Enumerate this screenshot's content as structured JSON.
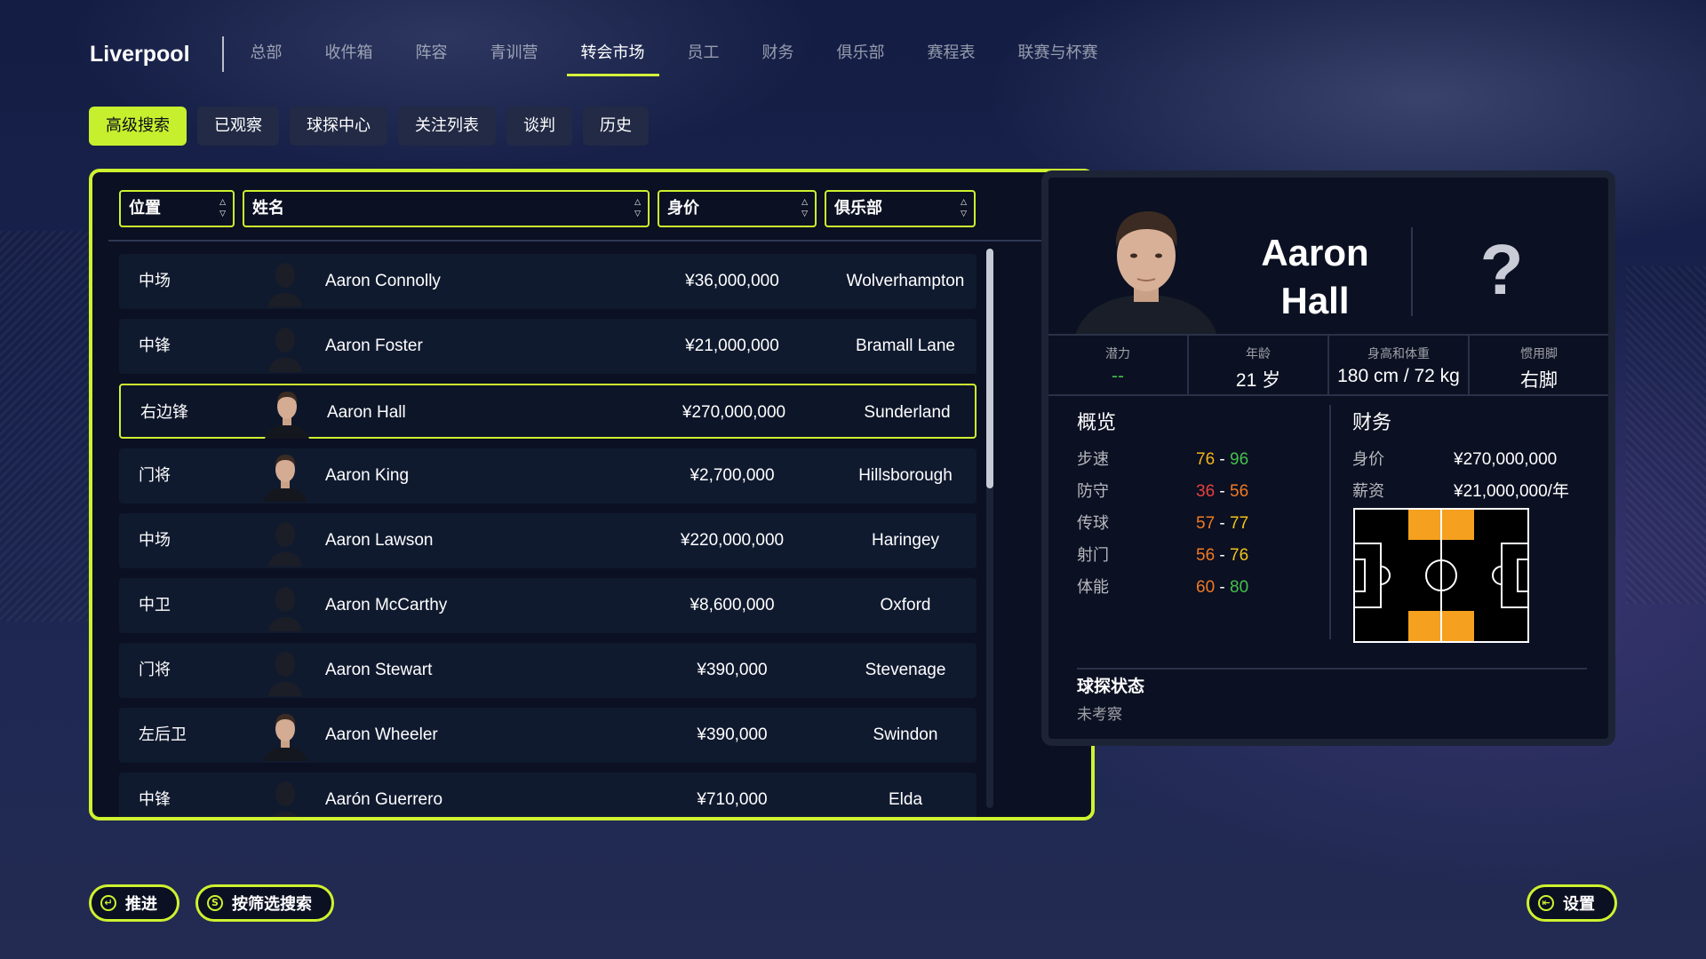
{
  "nav": {
    "club_name": "Liverpool",
    "items": [
      "总部",
      "收件箱",
      "阵容",
      "青训营",
      "转会市场",
      "员工",
      "财务",
      "俱乐部",
      "赛程表",
      "联赛与杯赛"
    ],
    "active_index": 4
  },
  "subtabs": {
    "items": [
      "高级搜索",
      "已观察",
      "球探中心",
      "关注列表",
      "谈判",
      "历史"
    ],
    "active_index": 0
  },
  "table": {
    "headers": {
      "position": "位置",
      "name": "姓名",
      "value": "身价",
      "club": "俱乐部"
    },
    "rows": [
      {
        "position": "中场",
        "name": "Aaron Connolly",
        "value": "¥36,000,000",
        "club": "Wolverhampton",
        "photo": "silhouette"
      },
      {
        "position": "中锋",
        "name": "Aaron Foster",
        "value": "¥21,000,000",
        "club": "Bramall Lane",
        "photo": "silhouette"
      },
      {
        "position": "右边锋",
        "name": "Aaron Hall",
        "value": "¥270,000,000",
        "club": "Sunderland",
        "photo": "portrait",
        "selected": true
      },
      {
        "position": "门将",
        "name": "Aaron King",
        "value": "¥2,700,000",
        "club": "Hillsborough",
        "photo": "portrait"
      },
      {
        "position": "中场",
        "name": "Aaron Lawson",
        "value": "¥220,000,000",
        "club": "Haringey",
        "photo": "silhouette"
      },
      {
        "position": "中卫",
        "name": "Aaron McCarthy",
        "value": "¥8,600,000",
        "club": "Oxford",
        "photo": "silhouette"
      },
      {
        "position": "门将",
        "name": "Aaron Stewart",
        "value": "¥390,000",
        "club": "Stevenage",
        "photo": "silhouette"
      },
      {
        "position": "左后卫",
        "name": "Aaron Wheeler",
        "value": "¥390,000",
        "club": "Swindon",
        "photo": "portrait"
      },
      {
        "position": "中锋",
        "name": "Aarón Guerrero",
        "value": "¥710,000",
        "club": "Elda",
        "photo": "silhouette"
      }
    ]
  },
  "detail": {
    "first_name": "Aaron",
    "last_name": "Hall",
    "question_mark": "?",
    "stats": [
      {
        "label": "潜力",
        "value": "--"
      },
      {
        "label": "年龄",
        "value": "21 岁"
      },
      {
        "label": "身高和体重",
        "value": "180 cm / 72 kg"
      },
      {
        "label": "惯用脚",
        "value": "右脚"
      }
    ],
    "overview_title": "概览",
    "attributes": [
      {
        "name": "步速",
        "low": "76",
        "high": "96",
        "low_color": "#f2b21a",
        "high_color": "#47c04e"
      },
      {
        "name": "防守",
        "low": "36",
        "high": "56",
        "low_color": "#e84040",
        "high_color": "#f07a22"
      },
      {
        "name": "传球",
        "low": "57",
        "high": "77",
        "low_color": "#f07a22",
        "high_color": "#f2c21a"
      },
      {
        "name": "射门",
        "low": "56",
        "high": "76",
        "low_color": "#f07a22",
        "high_color": "#f2c21a"
      },
      {
        "name": "体能",
        "low": "60",
        "high": "80",
        "low_color": "#f07a22",
        "high_color": "#47c04e"
      }
    ],
    "finance_title": "财务",
    "finance": [
      {
        "label": "身价",
        "value": "¥270,000,000"
      },
      {
        "label": "薪资",
        "value": "¥21,000,000/年"
      }
    ],
    "scout_title": "球探状态",
    "scout_status": "未考察"
  },
  "buttons": {
    "advance": "推进",
    "filter_search": "按筛选搜索",
    "settings": "设置"
  },
  "colors": {
    "accent": "#cef22f",
    "panel": "#0b1022",
    "row": "#101a2f"
  }
}
